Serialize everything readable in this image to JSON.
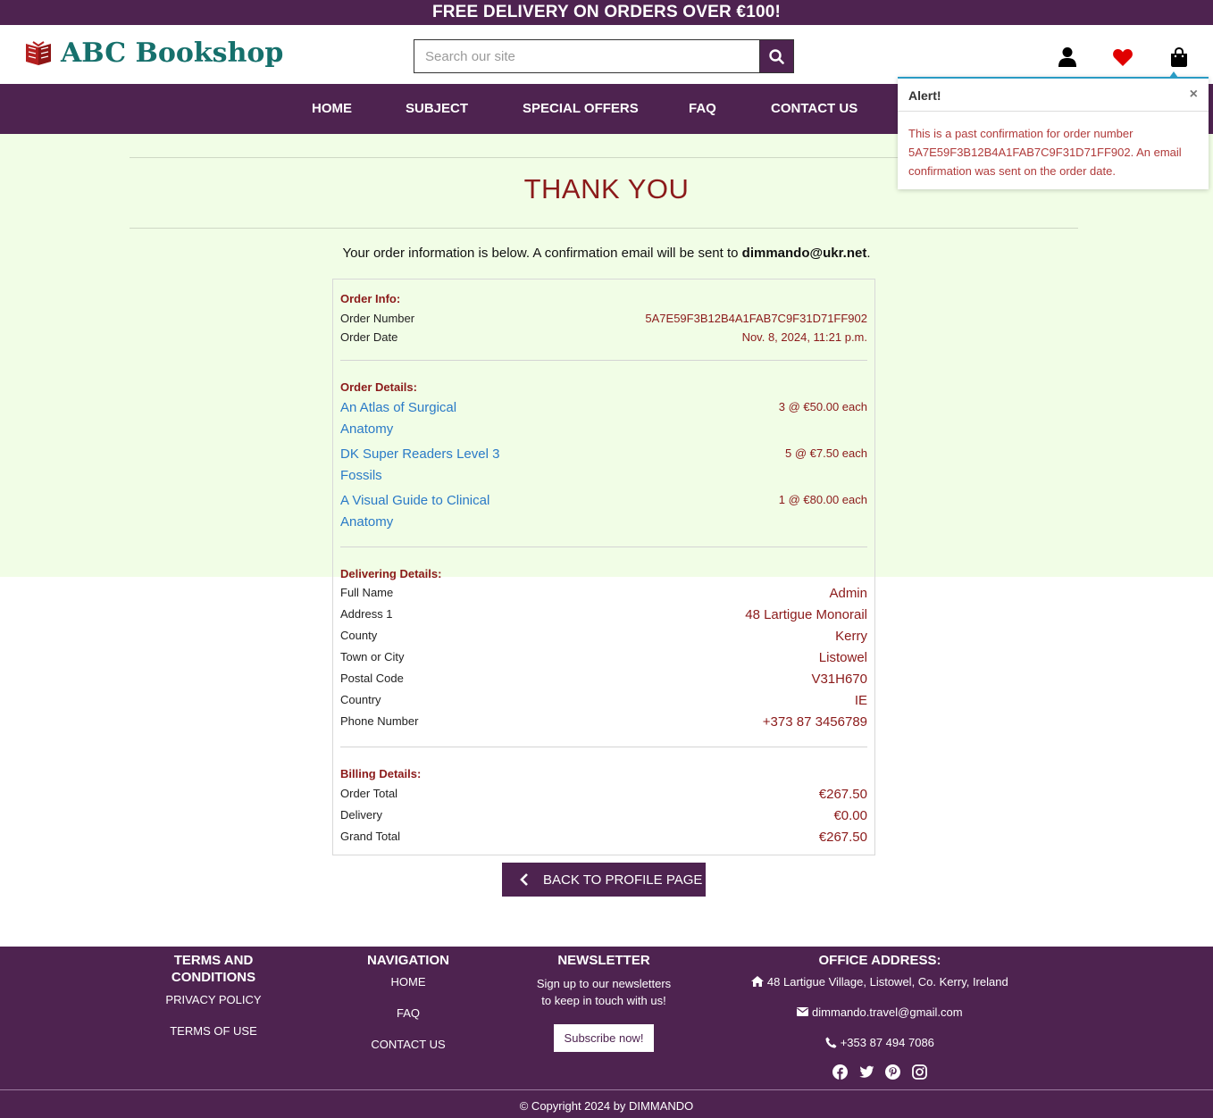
{
  "banner": {
    "text": "FREE DELIVERY ON ORDERS OVER €100!"
  },
  "header": {
    "logo_text": "ABC Bookshop",
    "search_placeholder": "Search our site",
    "icons": [
      "user-icon",
      "heart-icon",
      "shopping-bag-icon"
    ]
  },
  "nav": {
    "items": [
      "HOME",
      "SUBJECT",
      "SPECIAL OFFERS",
      "FAQ",
      "CONTACT US"
    ]
  },
  "page": {
    "title": "THANK YOU",
    "intro_prefix": "Your order information is below. A confirmation email will be sent to ",
    "intro_email": "dimmando@ukr.net",
    "intro_suffix": "."
  },
  "order_info": {
    "title": "Order Info:",
    "number_label": "Order Number",
    "number_value": "5A7E59F3B12B4A1FAB7C9F31D71FF902",
    "date_label": "Order Date",
    "date_value": "Nov. 8, 2024, 11:21 p.m."
  },
  "order_details": {
    "title": "Order Details:",
    "items": [
      {
        "line1": "An Atlas of Surgical",
        "line2": "Anatomy",
        "qty": "3 @ €50.00 each"
      },
      {
        "line1": "DK Super Readers Level 3",
        "line2": "Fossils",
        "qty": "5 @ €7.50 each"
      },
      {
        "line1": "A Visual Guide to Clinical",
        "line2": "Anatomy",
        "qty": "1 @ €80.00 each"
      }
    ]
  },
  "delivery": {
    "title": "Delivering Details:",
    "rows": [
      {
        "label": "Full Name",
        "value": "Admin"
      },
      {
        "label": "Address 1",
        "value": "48 Lartigue Monorail"
      },
      {
        "label": "County",
        "value": "Kerry"
      },
      {
        "label": "Town or City",
        "value": "Listowel"
      },
      {
        "label": "Postal Code",
        "value": "V31H670"
      },
      {
        "label": "Country",
        "value": "IE"
      },
      {
        "label": "Phone Number",
        "value": "+373 87 3456789"
      }
    ]
  },
  "billing": {
    "title": "Billing Details:",
    "rows": [
      {
        "label": "Order Total",
        "value": "€267.50"
      },
      {
        "label": "Delivery",
        "value": "€0.00"
      },
      {
        "label": "Grand Total",
        "value": "€267.50"
      }
    ]
  },
  "back_button": {
    "label": "BACK TO PROFILE PAGE"
  },
  "alert": {
    "title": "Alert!",
    "close": "×",
    "message": "This is a past confirmation for order number 5A7E59F3B12B4A1FAB7C9F31D71FF902. An email confirmation was sent on the order date."
  },
  "footer": {
    "terms": {
      "heading_line1": "TERMS AND",
      "heading_line2": "CONDITIONS",
      "links": [
        "PRIVACY POLICY",
        "TERMS OF USE"
      ]
    },
    "navigation": {
      "heading": "NAVIGATION",
      "links": [
        "HOME",
        "FAQ",
        "CONTACT US"
      ]
    },
    "newsletter": {
      "heading": "NEWSLETTER",
      "line1": "Sign up to our newsletters",
      "line2": "to keep in touch with us!",
      "button": "Subscribe now!"
    },
    "office": {
      "heading": "OFFICE ADDRESS:",
      "address": "48 Lartigue Village, Listowel, Co. Kerry, Ireland",
      "email": "dimmando.travel@gmail.com",
      "phone": "+353 87 494 7086",
      "social_icons": [
        "facebook-icon",
        "twitter-icon",
        "pinterest-icon",
        "instagram-icon"
      ]
    },
    "copyright": "© Copyright 2024 by DIMMANDO"
  },
  "colors": {
    "brand": "#4e2350",
    "accent_red": "#8b1a1a",
    "link_blue": "#2a7ac7",
    "logo_teal": "#16706c",
    "page_bg": "#f1fde6"
  }
}
